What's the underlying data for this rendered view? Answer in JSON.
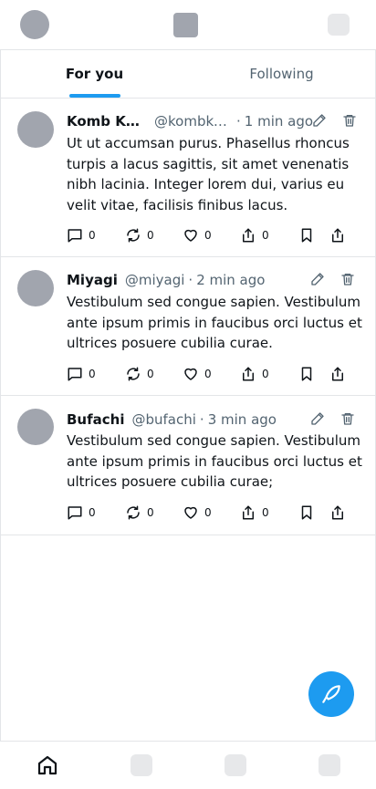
{
  "header": {
    "avatar_icon": "user-avatar",
    "logo_icon": "app-logo",
    "settings_icon": "settings-icon"
  },
  "tabs": [
    {
      "label": "For you",
      "active": true
    },
    {
      "label": "Following",
      "active": false
    }
  ],
  "posts": [
    {
      "name": "Komb Kar...",
      "handle": "@kombka...",
      "separator": "·",
      "time": "1 min ago",
      "text": "Ut ut accumsan purus. Phasellus rhoncus turpis a lacus sagittis, sit amet venenatis nibh lacinia. Integer lorem dui, varius eu velit vitae, facilisis finibus lacus.",
      "replies": "0",
      "reposts": "0",
      "likes": "0",
      "shares": "0"
    },
    {
      "name": "Miyagi",
      "handle": "@miyagi",
      "separator": "·",
      "time": "2 min ago",
      "text": "Vestibulum sed congue sapien. Vestibulum ante ipsum primis in faucibus orci luctus et ultrices posuere cubilia curae.",
      "replies": "0",
      "reposts": "0",
      "likes": "0",
      "shares": "0"
    },
    {
      "name": "Bufachi",
      "handle": "@bufachi",
      "separator": "·",
      "time": "3 min ago",
      "text": "Vestibulum sed congue sapien. Vestibulum ante ipsum primis in faucibus orci luctus et ultrices posuere cubilia curae;",
      "replies": "0",
      "reposts": "0",
      "likes": "0",
      "shares": "0"
    }
  ],
  "fab": {
    "icon": "compose-feather-icon"
  },
  "bottom_nav": [
    {
      "icon": "home-icon",
      "active": true
    },
    {
      "icon": "search-icon",
      "active": false
    },
    {
      "icon": "notifications-icon",
      "active": false
    },
    {
      "icon": "messages-icon",
      "active": false
    }
  ],
  "colors": {
    "accent": "#1d9bf0",
    "text_primary": "#0f1419",
    "text_secondary": "#536471",
    "border": "#e3e5e8",
    "placeholder": "#a1a5ae"
  }
}
